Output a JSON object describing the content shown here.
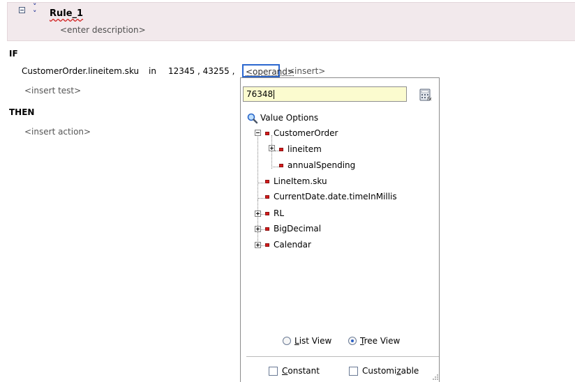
{
  "rule": {
    "name": "Rule_1",
    "description_placeholder": "<enter description>"
  },
  "if_keyword": "IF",
  "condition": {
    "left": "CustomerOrder.lineitem.sku",
    "operator": "in",
    "values_text": "12345 , 43255 ,",
    "operand_placeholder": "<operand>",
    "insert_placeholder": "<insert>"
  },
  "insert_test_placeholder": "<insert test>",
  "then_keyword": "THEN",
  "insert_action_placeholder": "<insert action>",
  "popup": {
    "input_value": "76348",
    "value_options_label": "Value Options",
    "tree": {
      "customer_order": "CustomerOrder",
      "lineitem": "lineitem",
      "annual_spending": "annualSpending",
      "lineitem_sku": "LineItem.sku",
      "current_date": "CurrentDate.date.timeInMillis",
      "rl": "RL",
      "big_decimal": "BigDecimal",
      "calendar": "Calendar"
    },
    "list_view_label_mnemonic": "L",
    "list_view_label_rest": "ist View",
    "tree_view_label_mnemonic": "T",
    "tree_view_label_rest": "ree View",
    "view_selected": "Tree View",
    "constant_label_mnemonic": "C",
    "constant_label_rest": "onstant",
    "customizable_label_pre": "Customi",
    "customizable_label_mnemonic": "z",
    "customizable_label_post": "able",
    "constant_checked": false,
    "customizable_checked": false
  },
  "colors": {
    "header_bg": "#f2e9ec",
    "operand_border": "#2b67cf",
    "input_bg": "#fbfbcf",
    "node_red": "#d61c1c"
  }
}
